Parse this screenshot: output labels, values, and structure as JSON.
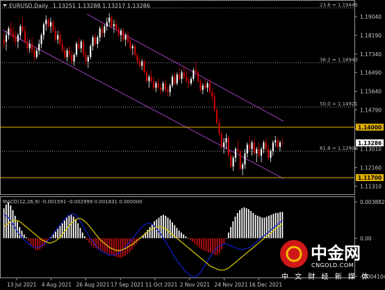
{
  "header": {
    "symbol": "EURUSD,Daily",
    "ohlc": "1.13251 1.13288 1.13217 1.13286",
    "menu_icon": "triangle-down-icon"
  },
  "colors": {
    "background": "#000000",
    "bull": "#ffffff",
    "bear": "#d00000",
    "channel": "#a040c0",
    "level_line": "#e0b000",
    "macd_hist_pos": "#ffffff",
    "macd_hist_neg": "#c01010",
    "macd_fast": "#1020d0",
    "macd_slow": "#e0d000",
    "grid_dotted": "#bfbfbf",
    "watermark_red": "#d01818"
  },
  "chart_data": [
    {
      "type": "candlestick",
      "title": "EURUSD,Daily",
      "ylim": [
        1.1097,
        1.1974
      ],
      "y_ticks": [
        "1.19040",
        "1.18190",
        "1.17340",
        "1.16490",
        "1.15640",
        "1.14790",
        "1.13930",
        "1.13010",
        "1.12160",
        "1.11310"
      ],
      "x_ticks": [
        "13 Jul 2021",
        "4 Aug 2021",
        "26 Aug 2021",
        "17 Sep 2021",
        "11 Oct 2021",
        "2 Nov 2021",
        "24 Nov 2021",
        "16 Dec 2021"
      ],
      "fib_levels": [
        {
          "label": "23.6 = 1.19445",
          "value": 1.19445
        },
        {
          "label": "38.2 = 1.16943",
          "value": 1.16943
        },
        {
          "label": "50.0 = 1.14921",
          "value": 1.14921
        },
        {
          "label": "61.8 = 1.12900",
          "value": 1.129
        }
      ],
      "horizontal_levels": [
        {
          "label": "1.14000",
          "value": 1.14
        },
        {
          "label": "1.11700",
          "value": 1.117
        }
      ],
      "current_price": {
        "label": "1.13286",
        "value": 1.13286
      },
      "channel": {
        "upper": [
          {
            "date": "2021-08-28",
            "value": 1.1916
          },
          {
            "date": "2021-12-30",
            "value": 1.1427
          }
        ],
        "lower": [
          {
            "date": "2021-07-06",
            "value": 1.1843
          },
          {
            "date": "2021-12-30",
            "value": 1.1165
          }
        ]
      },
      "candles": [
        [
          1.18,
          1.183,
          1.176,
          1.178
        ],
        [
          1.179,
          1.184,
          1.175,
          1.182
        ],
        [
          1.182,
          1.186,
          1.18,
          1.185
        ],
        [
          1.185,
          1.188,
          1.181,
          1.183
        ],
        [
          1.183,
          1.186,
          1.179,
          1.181
        ],
        [
          1.181,
          1.184,
          1.177,
          1.179
        ],
        [
          1.179,
          1.183,
          1.176,
          1.182
        ],
        [
          1.182,
          1.187,
          1.18,
          1.186
        ],
        [
          1.186,
          1.19,
          1.183,
          1.184
        ],
        [
          1.184,
          1.186,
          1.178,
          1.179
        ],
        [
          1.179,
          1.181,
          1.174,
          1.176
        ],
        [
          1.176,
          1.18,
          1.174,
          1.178
        ],
        [
          1.178,
          1.181,
          1.173,
          1.175
        ],
        [
          1.175,
          1.177,
          1.17,
          1.172
        ],
        [
          1.172,
          1.176,
          1.171,
          1.175
        ],
        [
          1.175,
          1.18,
          1.173,
          1.178
        ],
        [
          1.178,
          1.183,
          1.176,
          1.182
        ],
        [
          1.182,
          1.188,
          1.18,
          1.187
        ],
        [
          1.187,
          1.191,
          1.184,
          1.189
        ],
        [
          1.189,
          1.19,
          1.185,
          1.186
        ],
        [
          1.186,
          1.19,
          1.183,
          1.188
        ],
        [
          1.188,
          1.189,
          1.183,
          1.184
        ],
        [
          1.184,
          1.186,
          1.179,
          1.18
        ],
        [
          1.18,
          1.184,
          1.178,
          1.182
        ],
        [
          1.182,
          1.184,
          1.177,
          1.178
        ],
        [
          1.178,
          1.18,
          1.174,
          1.175
        ],
        [
          1.175,
          1.177,
          1.171,
          1.172
        ],
        [
          1.172,
          1.176,
          1.17,
          1.175
        ],
        [
          1.175,
          1.177,
          1.171,
          1.173
        ],
        [
          1.173,
          1.175,
          1.169,
          1.17
        ],
        [
          1.17,
          1.174,
          1.168,
          1.173
        ],
        [
          1.173,
          1.179,
          1.172,
          1.178
        ],
        [
          1.178,
          1.181,
          1.175,
          1.176
        ],
        [
          1.176,
          1.18,
          1.174,
          1.179
        ],
        [
          1.179,
          1.18,
          1.172,
          1.173
        ],
        [
          1.173,
          1.175,
          1.168,
          1.17
        ],
        [
          1.17,
          1.173,
          1.167,
          1.172
        ],
        [
          1.172,
          1.178,
          1.171,
          1.177
        ],
        [
          1.177,
          1.182,
          1.175,
          1.181
        ],
        [
          1.181,
          1.183,
          1.177,
          1.178
        ],
        [
          1.178,
          1.182,
          1.176,
          1.181
        ],
        [
          1.181,
          1.186,
          1.179,
          1.185
        ],
        [
          1.185,
          1.188,
          1.181,
          1.183
        ],
        [
          1.183,
          1.187,
          1.181,
          1.186
        ],
        [
          1.186,
          1.19,
          1.184,
          1.188
        ],
        [
          1.188,
          1.192,
          1.186,
          1.19
        ],
        [
          1.19,
          1.191,
          1.185,
          1.186
        ],
        [
          1.186,
          1.189,
          1.183,
          1.187
        ],
        [
          1.187,
          1.189,
          1.184,
          1.185
        ],
        [
          1.185,
          1.186,
          1.181,
          1.182
        ],
        [
          1.182,
          1.185,
          1.179,
          1.184
        ],
        [
          1.184,
          1.185,
          1.179,
          1.18
        ],
        [
          1.18,
          1.183,
          1.177,
          1.182
        ],
        [
          1.182,
          1.184,
          1.178,
          1.179
        ],
        [
          1.179,
          1.181,
          1.175,
          1.176
        ],
        [
          1.176,
          1.178,
          1.173,
          1.177
        ],
        [
          1.177,
          1.178,
          1.172,
          1.173
        ],
        [
          1.173,
          1.174,
          1.169,
          1.17
        ],
        [
          1.17,
          1.172,
          1.167,
          1.168
        ],
        [
          1.168,
          1.171,
          1.166,
          1.17
        ],
        [
          1.17,
          1.171,
          1.164,
          1.165
        ],
        [
          1.165,
          1.166,
          1.16,
          1.161
        ],
        [
          1.161,
          1.164,
          1.158,
          1.163
        ],
        [
          1.163,
          1.166,
          1.16,
          1.161
        ],
        [
          1.161,
          1.163,
          1.157,
          1.158
        ],
        [
          1.158,
          1.161,
          1.156,
          1.16
        ],
        [
          1.16,
          1.162,
          1.157,
          1.158
        ],
        [
          1.158,
          1.16,
          1.155,
          1.157
        ],
        [
          1.157,
          1.161,
          1.156,
          1.16
        ],
        [
          1.16,
          1.162,
          1.156,
          1.157
        ],
        [
          1.157,
          1.159,
          1.154,
          1.156
        ],
        [
          1.156,
          1.16,
          1.154,
          1.159
        ],
        [
          1.159,
          1.164,
          1.158,
          1.163
        ],
        [
          1.163,
          1.165,
          1.159,
          1.16
        ],
        [
          1.16,
          1.165,
          1.159,
          1.164
        ],
        [
          1.164,
          1.167,
          1.161,
          1.162
        ],
        [
          1.162,
          1.166,
          1.16,
          1.165
        ],
        [
          1.165,
          1.168,
          1.162,
          1.163
        ],
        [
          1.163,
          1.166,
          1.16,
          1.161
        ],
        [
          1.161,
          1.163,
          1.158,
          1.16
        ],
        [
          1.16,
          1.163,
          1.159,
          1.162
        ],
        [
          1.162,
          1.167,
          1.161,
          1.166
        ],
        [
          1.166,
          1.17,
          1.163,
          1.165
        ],
        [
          1.165,
          1.166,
          1.16,
          1.161
        ],
        [
          1.161,
          1.162,
          1.156,
          1.157
        ],
        [
          1.157,
          1.16,
          1.155,
          1.159
        ],
        [
          1.159,
          1.162,
          1.157,
          1.158
        ],
        [
          1.158,
          1.161,
          1.156,
          1.16
        ],
        [
          1.16,
          1.162,
          1.155,
          1.156
        ],
        [
          1.156,
          1.158,
          1.152,
          1.154
        ],
        [
          1.154,
          1.156,
          1.147,
          1.148
        ],
        [
          1.148,
          1.149,
          1.141,
          1.142
        ],
        [
          1.142,
          1.144,
          1.136,
          1.137
        ],
        [
          1.137,
          1.138,
          1.13,
          1.131
        ],
        [
          1.131,
          1.135,
          1.128,
          1.133
        ],
        [
          1.133,
          1.137,
          1.13,
          1.135
        ],
        [
          1.135,
          1.136,
          1.126,
          1.127
        ],
        [
          1.127,
          1.129,
          1.121,
          1.122
        ],
        [
          1.122,
          1.127,
          1.12,
          1.126
        ],
        [
          1.126,
          1.131,
          1.124,
          1.13
        ],
        [
          1.13,
          1.134,
          1.128,
          1.129
        ],
        [
          1.129,
          1.13,
          1.12,
          1.121
        ],
        [
          1.121,
          1.124,
          1.118,
          1.123
        ],
        [
          1.123,
          1.13,
          1.121,
          1.128
        ],
        [
          1.128,
          1.133,
          1.126,
          1.132
        ],
        [
          1.132,
          1.136,
          1.129,
          1.13
        ],
        [
          1.13,
          1.134,
          1.127,
          1.133
        ],
        [
          1.133,
          1.135,
          1.127,
          1.128
        ],
        [
          1.128,
          1.131,
          1.124,
          1.13
        ],
        [
          1.13,
          1.133,
          1.126,
          1.127
        ],
        [
          1.127,
          1.131,
          1.124,
          1.13
        ],
        [
          1.13,
          1.134,
          1.128,
          1.133
        ],
        [
          1.133,
          1.135,
          1.129,
          1.13
        ],
        [
          1.13,
          1.132,
          1.125,
          1.126
        ],
        [
          1.126,
          1.13,
          1.124,
          1.129
        ],
        [
          1.129,
          1.134,
          1.127,
          1.133
        ],
        [
          1.133,
          1.136,
          1.131,
          1.134
        ],
        [
          1.134,
          1.135,
          1.13,
          1.131
        ],
        [
          1.131,
          1.134,
          1.129,
          1.133
        ],
        [
          1.133,
          1.135,
          1.131,
          1.1329
        ]
      ]
    },
    {
      "type": "bar",
      "title": "MACD(12,26,9) -0.001591 -0.002999 0.001831 0.000000",
      "ylim": [
        -0.0042,
        0.0044
      ],
      "y_ticks": [
        "0.003882",
        "0.00",
        "-0.004104"
      ],
      "histogram": [
        0.0032,
        0.0036,
        0.0038,
        0.0035,
        0.003,
        0.0024,
        0.0018,
        0.0012,
        0.0008,
        0.0004,
        0.0001,
        -0.0003,
        -0.0007,
        -0.001,
        -0.0012,
        -0.0013,
        -0.0012,
        -0.001,
        -0.0008,
        -0.0005,
        -0.0002,
        0.0001,
        0.0004,
        0.0007,
        0.001,
        0.0013,
        0.0016,
        0.0019,
        0.0022,
        0.0024,
        0.0025,
        0.0023,
        0.002,
        0.0016,
        0.0011,
        0.0006,
        0.0002,
        -0.0002,
        -0.0005,
        -0.0008,
        -0.001,
        -0.0011,
        -0.0012,
        -0.0013,
        -0.0014,
        -0.0015,
        -0.0016,
        -0.0017,
        -0.0018,
        -0.0019,
        -0.002,
        -0.0021,
        -0.0021,
        -0.002,
        -0.0019,
        -0.0017,
        -0.0015,
        -0.0012,
        -0.0009,
        -0.0006,
        -0.0003,
        0.0,
        0.0003,
        0.0006,
        0.0009,
        0.0012,
        0.0015,
        0.0018,
        0.002,
        0.0022,
        0.0024,
        0.0025,
        0.0024,
        0.0022,
        0.002,
        0.0017,
        0.0014,
        0.0011,
        0.0008,
        0.0006,
        0.0004,
        0.0002,
        0.0,
        -0.0002,
        -0.0004,
        -0.0006,
        -0.0008,
        -0.001,
        -0.0012,
        -0.0013,
        -0.0014,
        -0.0015,
        -0.0016,
        -0.0017,
        -0.0018,
        -0.0018,
        -0.0016,
        -0.0012,
        -0.0006,
        0.0,
        0.0006,
        0.0012,
        0.0018,
        0.0023,
        0.0027,
        0.003,
        0.0032,
        0.0033,
        0.0032,
        0.0031,
        0.0029,
        0.0027,
        0.0025,
        0.0024,
        0.0023,
        0.0022,
        0.0022,
        0.0023,
        0.0024,
        0.0025,
        0.0026,
        0.0027,
        0.0027,
        0.0028,
        0.0028
      ],
      "signal": [
        0.0012,
        0.0014,
        0.0016,
        0.0018,
        0.0019,
        0.0019,
        0.0019,
        0.0018,
        0.0016,
        0.0014,
        0.0012,
        0.001,
        0.0008,
        0.0006,
        0.0004,
        0.0002,
        0.0,
        -0.0002,
        -0.0003,
        -0.0004,
        -0.0005,
        -0.0005,
        -0.0004,
        -0.0003,
        -0.0001,
        0.0001,
        0.0004,
        0.0007,
        0.001,
        0.0013,
        0.0016,
        0.0018,
        0.002,
        0.0021,
        0.0021,
        0.002,
        0.0018,
        0.0016,
        0.0013,
        0.001,
        0.0007,
        0.0004,
        0.0001,
        -0.0002,
        -0.0004,
        -0.0006,
        -0.0008,
        -0.001,
        -0.0011,
        -0.0012,
        -0.0013,
        -0.0013,
        -0.0013,
        -0.0012,
        -0.0011,
        -0.001,
        -0.0008,
        -0.0007,
        -0.0005,
        -0.0003,
        -0.0001,
        0.0001,
        0.0003,
        0.0005,
        0.0007,
        0.0009,
        0.001,
        0.0011,
        0.0012,
        0.0012,
        0.0012,
        0.0011,
        0.001,
        0.0008,
        0.0006,
        0.0004,
        0.0002,
        0.0,
        -0.0002,
        -0.0004,
        -0.0006,
        -0.0008,
        -0.001,
        -0.0012,
        -0.0014,
        -0.0016,
        -0.0018,
        -0.002,
        -0.0022,
        -0.0024,
        -0.0026,
        -0.0028,
        -0.003,
        -0.0031,
        -0.0032,
        -0.0033,
        -0.0034,
        -0.0034,
        -0.0034,
        -0.0033,
        -0.0032,
        -0.003,
        -0.0028,
        -0.0026,
        -0.0024,
        -0.0022,
        -0.002,
        -0.0018,
        -0.0016,
        -0.0014,
        -0.0012,
        -0.001,
        -0.0008,
        -0.0006,
        -0.0004,
        -0.0002,
        0.0,
        0.0002,
        0.0004,
        0.0006,
        0.0008,
        0.001,
        0.0012,
        0.0014,
        0.0016
      ],
      "fast": [
        0.0025,
        0.0024,
        0.0022,
        0.0019,
        0.0015,
        0.0011,
        0.0007,
        0.0004,
        0.0001,
        -0.0002,
        -0.0004,
        -0.0006,
        -0.0008,
        -0.0009,
        -0.001,
        -0.001,
        -0.0009,
        -0.0008,
        -0.0006,
        -0.0004,
        -0.0001,
        0.0002,
        0.0005,
        0.0008,
        0.0011,
        0.0014,
        0.0017,
        0.002,
        0.0023,
        0.0025,
        0.0026,
        0.0026,
        0.0025,
        0.0022,
        0.0018,
        0.0014,
        0.001,
        0.0006,
        0.0002,
        -0.0002,
        -0.0005,
        -0.0008,
        -0.0011,
        -0.0013,
        -0.0015,
        -0.0016,
        -0.0017,
        -0.0018,
        -0.0018,
        -0.0018,
        -0.0017,
        -0.0016,
        -0.0014,
        -0.0012,
        -0.001,
        -0.0007,
        -0.0004,
        -0.0001,
        0.0002,
        0.0005,
        0.0008,
        0.0011,
        0.0013,
        0.0015,
        0.0016,
        0.0016,
        0.0015,
        0.0013,
        0.001,
        0.0007,
        0.0004,
        0.0,
        -0.0004,
        -0.0008,
        -0.0012,
        -0.0016,
        -0.002,
        -0.0024,
        -0.0027,
        -0.003,
        -0.0033,
        -0.0036,
        -0.0038,
        -0.004,
        -0.0041,
        -0.0041,
        -0.004,
        -0.0038,
        -0.0035,
        -0.0031,
        -0.0027,
        -0.0023,
        -0.0019,
        -0.0016,
        -0.0013,
        -0.001,
        -0.0008,
        -0.0007,
        -0.0006,
        -0.0006,
        -0.0007,
        -0.0008,
        -0.0009,
        -0.001,
        -0.0011,
        -0.0012,
        -0.0012,
        -0.0012,
        -0.0011,
        -0.001,
        -0.0009,
        -0.0007,
        -0.0005,
        -0.0003,
        -0.0001,
        0.0001,
        0.0003,
        0.0005,
        0.0007,
        0.0009,
        0.0011,
        0.0013,
        0.0015,
        0.0017,
        0.0019
      ]
    }
  ],
  "watermark": {
    "brand": "中金网",
    "url": "CNGOLD.COM",
    "tagline": "中 文 财 经 新 媒 体"
  }
}
